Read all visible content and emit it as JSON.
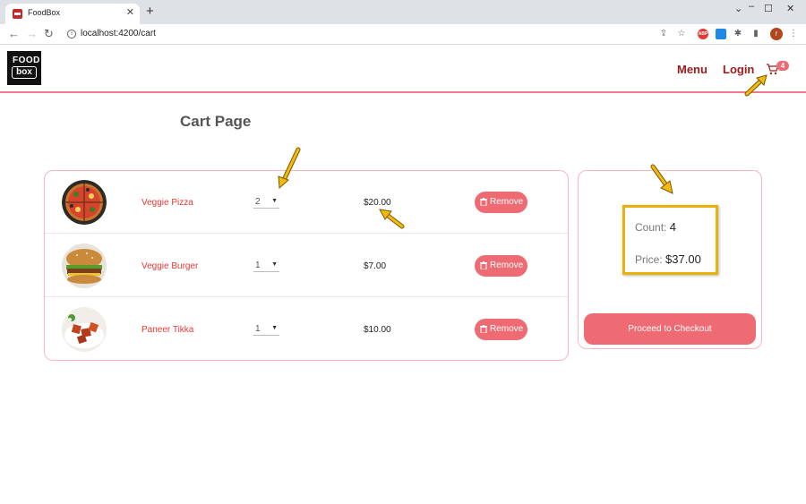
{
  "browser": {
    "tab_title": "FoodBox",
    "new_tab_glyph": "+",
    "url": "localhost:4200/cart",
    "profile_initial": "r",
    "abp_label": "ABP"
  },
  "header": {
    "logo_top": "FOOD",
    "logo_bottom": "box",
    "nav": [
      "Menu",
      "Login"
    ],
    "cart_count": "4"
  },
  "page": {
    "title": "Cart Page"
  },
  "cart": {
    "items": [
      {
        "name": "Veggie Pizza",
        "quantity": "2",
        "price": "$20.00",
        "remove_label": "Remove"
      },
      {
        "name": "Veggie Burger",
        "quantity": "1",
        "price": "$7.00",
        "remove_label": "Remove"
      },
      {
        "name": "Paneer Tikka",
        "quantity": "1",
        "price": "$10.00",
        "remove_label": "Remove"
      }
    ]
  },
  "summary": {
    "count_label": "Count:",
    "count_value": "4",
    "price_label": "Price:",
    "price_value": "$37.00",
    "checkout_label": "Proceed to Checkout"
  },
  "colors": {
    "accent": "#ef6b73",
    "brand_text": "#9b1c1c",
    "item_name": "#e53935",
    "annotation": "#e8b20c"
  },
  "icons": [
    "back-icon",
    "forward-icon",
    "reload-icon",
    "info-icon",
    "share-icon",
    "star-icon",
    "extension-icon",
    "sidebar-icon",
    "kebab-menu-icon",
    "cart-icon",
    "trash-icon"
  ]
}
